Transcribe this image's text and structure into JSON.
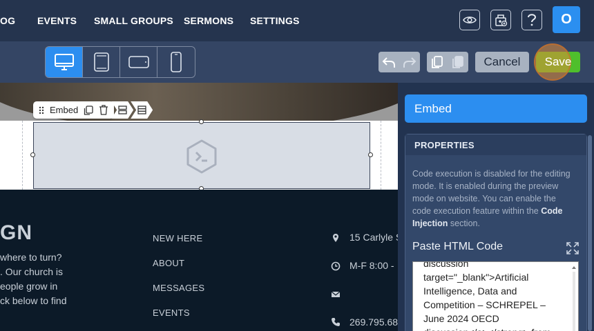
{
  "nav": {
    "items": [
      "OG",
      "EVENTS",
      "SMALL GROUPS",
      "SERMONS",
      "SETTINGS"
    ],
    "avatar_initial": "O",
    "icons": [
      "eye-icon",
      "gift-icon",
      "help-icon"
    ]
  },
  "toolbar": {
    "devices": [
      "desktop-icon",
      "tablet-icon",
      "tablet-landscape-icon",
      "mobile-icon"
    ],
    "active_device": "desktop",
    "cancel_label": "Cancel",
    "save_label": "Save"
  },
  "canvas": {
    "embed_toolbar_label": "Embed",
    "footer": {
      "brand_fragment": "GN",
      "intro_lines": [
        "where to turn?",
        ". Our church is",
        "eople grow in",
        "ck below to find"
      ],
      "links": [
        "NEW HERE",
        "ABOUT",
        "MESSAGES",
        "EVENTS"
      ],
      "info": [
        "15 Carlyle S",
        "M-F 8:00 -",
        "",
        "269.795.68"
      ]
    }
  },
  "panel": {
    "title": "Embed",
    "properties_heading": "PROPERTIES",
    "note_part1": "Code execution is disabled for the editing mode. It is enabled during the preview mode on website. You can enable the code execution feature within the ",
    "note_bold1": "Code Injection",
    "note_part2": " section.",
    "paste_label": "Paste HTML Code",
    "code_value": "discussion\ntarget=\"_blank\">Artificial Intelligence, Data and Competition – SCHREPEL – June 2024 OECD discussion</a></strong> from"
  },
  "colors": {
    "accent": "#2c8ef0",
    "save": "#4fbf2c",
    "nav_bg": "#25344e",
    "toolbar_bg": "#344564",
    "footer_bg": "#0c1a28"
  }
}
